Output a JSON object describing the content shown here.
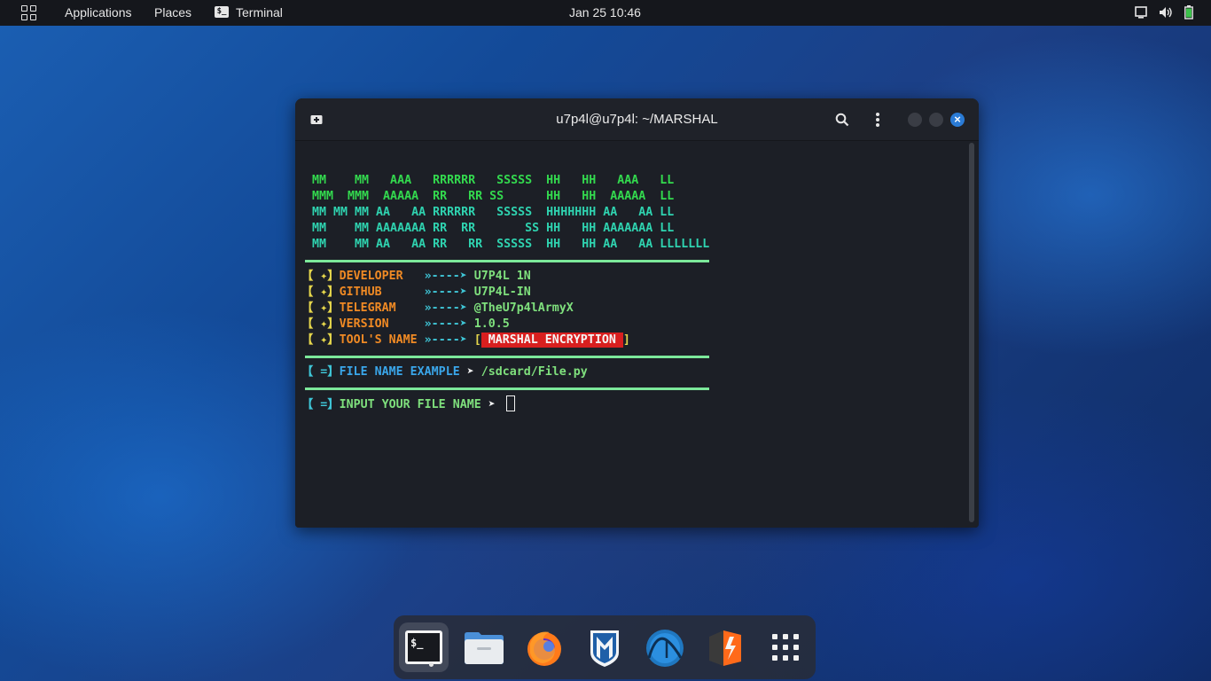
{
  "topbar": {
    "applications": "Applications",
    "places": "Places",
    "active_app": "Terminal",
    "active_app_icon": "terminal-icon",
    "clock": "Jan 25  10:46",
    "tray_icons": [
      "screen-icon",
      "volume-icon",
      "battery-icon"
    ]
  },
  "window": {
    "title": "u7p4l@u7p4l: ~/MARSHAL",
    "controls": [
      "new-tab-icon",
      "search-icon",
      "menu-icon",
      "minimize-button",
      "maximize-button",
      "close-button"
    ]
  },
  "terminal": {
    "banner": [
      "MM    MM   AAA   RRRRRR   SSSSS  HH   HH   AAA   LL",
      "MMM  MMM  AAAAA  RR   RR SS      HH   HH  AAAAA  LL",
      "MM MM MM AA   AA RRRRRR   SSSSS  HHHHHHH AA   AA LL",
      "MM    MM AAAAAAA RR  RR       SS HH   HH AAAAAAA LL",
      "MM    MM AA   AA RR   RR  SSSSS  HH   HH AA   AA LLLLLLL"
    ],
    "info": [
      {
        "bracket": "【 ✦】",
        "label": "DEVELOPER  ",
        "arrow": " »----➤ ",
        "value": "U7P4L 1N"
      },
      {
        "bracket": "【 ✦】",
        "label": "GITHUB     ",
        "arrow": " »----➤ ",
        "value": "U7P4L-IN"
      },
      {
        "bracket": "【 ✦】",
        "label": "TELEGRAM   ",
        "arrow": " »----➤ ",
        "value": "@TheU7p4lArmyX"
      },
      {
        "bracket": "【 ✦】",
        "label": "VERSION    ",
        "arrow": " »----➤ ",
        "value": "1.0.5"
      },
      {
        "bracket": "【 ✦】",
        "label": "TOOL'S NAME",
        "arrow": " »----➤ ",
        "value": "MARSHAL ENCRYPTION"
      }
    ],
    "example": {
      "bracket": "【 =】",
      "label": "FILE NAME EXAMPLE",
      "arrow": " ➤ ",
      "value": "/sdcard/File.py"
    },
    "prompt": {
      "bracket": "【 =】",
      "label": "INPUT YOUR FILE NAME",
      "arrow": " ➤ ",
      "value": ""
    }
  },
  "dock": {
    "items": [
      "terminal-icon",
      "files-icon",
      "firefox-icon",
      "metasploit-icon",
      "wireshark-icon",
      "burpsuite-icon",
      "app-grid-icon"
    ]
  },
  "colors": {
    "banner_green": "#33d94e",
    "banner_teal": "#2fd3b0",
    "label_orange": "#f08a24",
    "separator": "#7ce89a",
    "badge_red": "#d81f1f",
    "accent_blue": "#2a7bd6"
  }
}
